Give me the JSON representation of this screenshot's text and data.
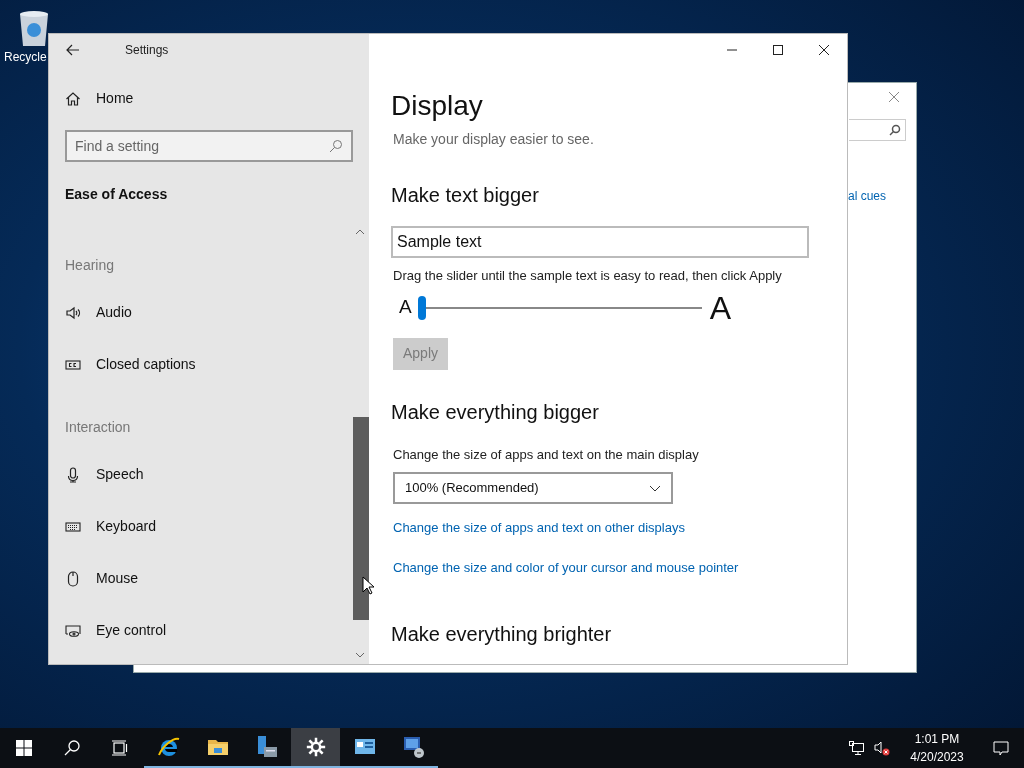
{
  "desktop": {
    "icon_label": "Recycle"
  },
  "back_window": {
    "link_text": "al cues"
  },
  "window": {
    "title": "Settings"
  },
  "sidebar": {
    "home": "Home",
    "search": {
      "placeholder": "Find a setting"
    },
    "section": "Ease of Access",
    "groups": [
      {
        "heading": "Hearing",
        "items": [
          {
            "label": "Audio"
          },
          {
            "label": "Closed captions"
          }
        ]
      },
      {
        "heading": "Interaction",
        "items": [
          {
            "label": "Speech"
          },
          {
            "label": "Keyboard"
          },
          {
            "label": "Mouse"
          },
          {
            "label": "Eye control"
          }
        ]
      }
    ]
  },
  "content": {
    "title": "Display",
    "subtitle": "Make your display easier to see.",
    "text_size": {
      "heading": "Make text bigger",
      "sample": "Sample text",
      "instruction": "Drag the slider until the sample text is easy to read, then click Apply",
      "small_label": "A",
      "large_label": "A",
      "level": 0,
      "apply": {
        "label": "Apply",
        "disabled": true
      }
    },
    "everything": {
      "heading": "Make everything bigger",
      "label": "Change the size of apps and text on the main display",
      "dropdown": "100% (Recommended)",
      "links": [
        "Change the size of apps and text on other displays",
        "Change the size and color of your cursor and mouse pointer"
      ]
    },
    "brighter": {
      "heading": "Make everything brighter"
    }
  },
  "taskbar": {
    "apps": [
      {
        "selected": false
      },
      {
        "selected": false
      },
      {
        "selected": false
      },
      {
        "selected": true
      },
      {
        "selected": false
      },
      {
        "selected": false
      }
    ],
    "time": "1:01 PM",
    "date": "4/20/2023"
  }
}
